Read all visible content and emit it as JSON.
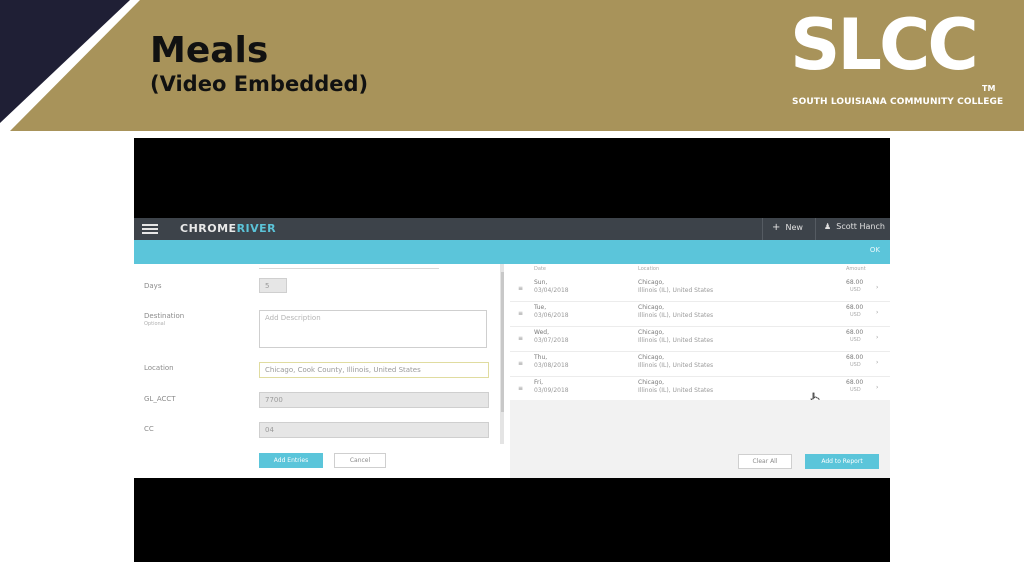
{
  "slide": {
    "title": "Meals",
    "subtitle": "(Video Embedded)",
    "logo": "SLCC",
    "logo_tm": "TM",
    "logo_subtitle": "SOUTH LOUISIANA COMMUNITY COLLEGE",
    "colors": {
      "band": "#a8935a",
      "navy": "#1f1f35",
      "accent": "#5bc5da"
    }
  },
  "app": {
    "brand_a": "CHROME",
    "brand_b": "RIVER",
    "new_label": "New",
    "user_label": "Scott Hanch",
    "ok_label": "OK"
  },
  "form": {
    "days_label": "Days",
    "days_value": "5",
    "destination_label": "Destination",
    "destination_sublabel": "Optional",
    "destination_placeholder": "Add Description",
    "location_label": "Location",
    "location_value": "Chicago, Cook County, Illinois, United States",
    "glacct_label": "GL_ACCT",
    "glacct_value": "7700",
    "cc_label": "CC",
    "cc_value": "04",
    "add_button": "Add Entries",
    "cancel_button": "Cancel"
  },
  "list": {
    "col_date": "Date",
    "col_location": "Location",
    "col_amount": "Amount",
    "rows": [
      {
        "day": "Sun,",
        "date": "03/04/2018",
        "city": "Chicago,",
        "region": "Illinois (IL), United States",
        "amount": "68.00",
        "unit": "USD"
      },
      {
        "day": "Tue,",
        "date": "03/06/2018",
        "city": "Chicago,",
        "region": "Illinois (IL), United States",
        "amount": "68.00",
        "unit": "USD"
      },
      {
        "day": "Wed,",
        "date": "03/07/2018",
        "city": "Chicago,",
        "region": "Illinois (IL), United States",
        "amount": "68.00",
        "unit": "USD"
      },
      {
        "day": "Thu,",
        "date": "03/08/2018",
        "city": "Chicago,",
        "region": "Illinois (IL), United States",
        "amount": "68.00",
        "unit": "USD"
      },
      {
        "day": "Fri,",
        "date": "03/09/2018",
        "city": "Chicago,",
        "region": "Illinois (IL), United States",
        "amount": "68.00",
        "unit": "USD"
      }
    ],
    "clear_button": "Clear All",
    "add_report_button": "Add to Report"
  }
}
